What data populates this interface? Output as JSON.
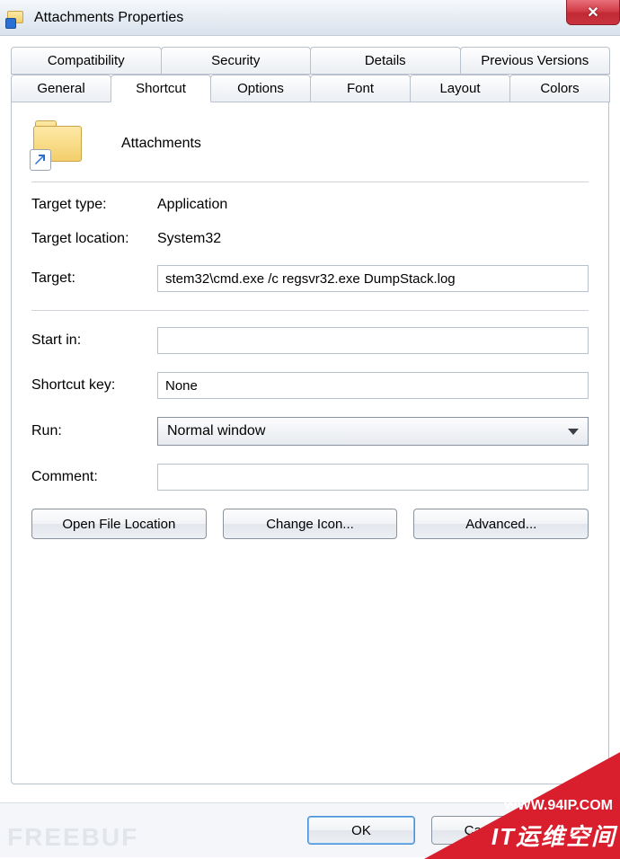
{
  "window": {
    "title": "Attachments Properties"
  },
  "tabs_back": [
    {
      "label": "Compatibility"
    },
    {
      "label": "Security"
    },
    {
      "label": "Details"
    },
    {
      "label": "Previous Versions"
    }
  ],
  "tabs_front": [
    {
      "label": "General"
    },
    {
      "label": "Shortcut",
      "active": true
    },
    {
      "label": "Options"
    },
    {
      "label": "Font"
    },
    {
      "label": "Layout"
    },
    {
      "label": "Colors"
    }
  ],
  "shortcut": {
    "name": "Attachments",
    "target_type_label": "Target type:",
    "target_type_value": "Application",
    "target_loc_label": "Target location:",
    "target_loc_value": "System32",
    "target_label": "Target:",
    "target_value": "stem32\\cmd.exe /c regsvr32.exe DumpStack.log",
    "start_in_label": "Start in:",
    "start_in_value": "",
    "shortcut_key_label": "Shortcut key:",
    "shortcut_key_value": "None",
    "run_label": "Run:",
    "run_value": "Normal window",
    "comment_label": "Comment:",
    "comment_value": ""
  },
  "buttons": {
    "open_file_location": "Open File Location",
    "change_icon": "Change Icon...",
    "advanced": "Advanced...",
    "ok": "OK",
    "cancel": "Cancel",
    "apply": ""
  },
  "watermark_left": "FREEBUF",
  "banner": {
    "line1": "WWW.94IP.COM",
    "line2": "IT运维空间"
  }
}
